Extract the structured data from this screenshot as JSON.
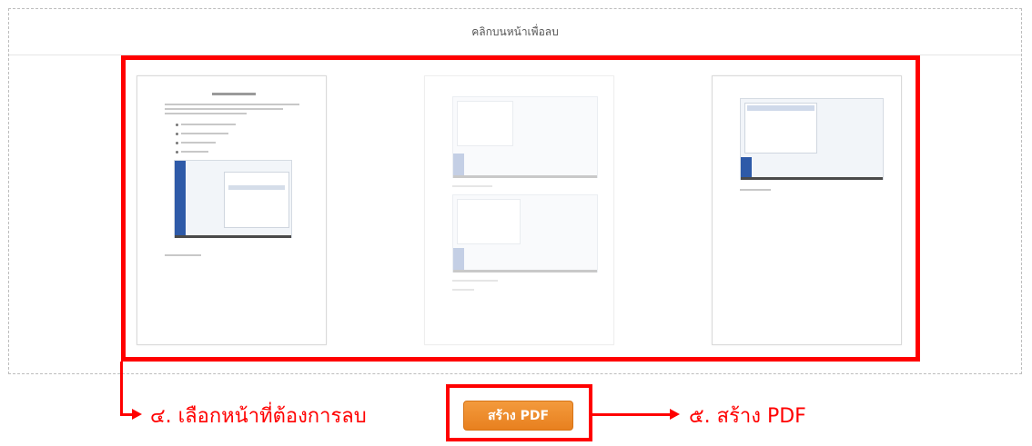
{
  "panel": {
    "header_text": "คลิกบนหน้าเพื่อลบ"
  },
  "pages": [
    {
      "name": "page-1",
      "state": "kept"
    },
    {
      "name": "page-2",
      "state": "selected-for-deletion"
    },
    {
      "name": "page-3",
      "state": "kept"
    }
  ],
  "actions": {
    "create_pdf_label": "สร้าง PDF"
  },
  "annotations": {
    "step4": "๔. เลือกหน้าที่ต้องการลบ",
    "step5": "๕. สร้าง PDF"
  },
  "colors": {
    "highlight": "#ff0000",
    "button": "#ee8a2a",
    "sidebar_blue": "#2e5aa8"
  }
}
